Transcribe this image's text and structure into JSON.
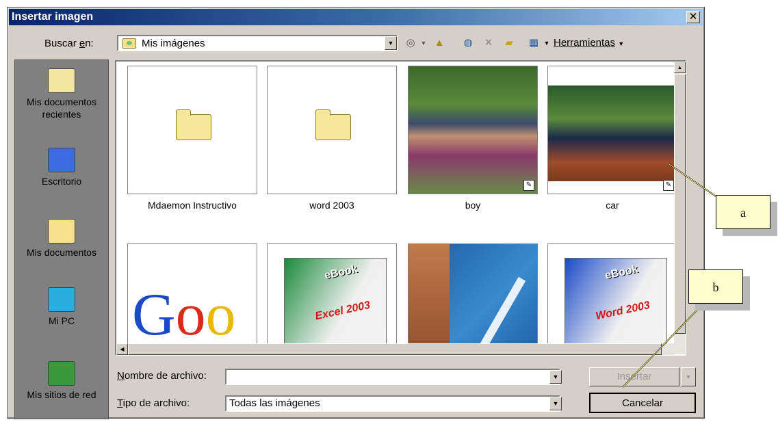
{
  "dialog": {
    "title": "Insertar imagen",
    "close_glyph": "✕"
  },
  "toolbar": {
    "look_in_label_pre": "Buscar ",
    "look_in_label_key": "e",
    "look_in_label_post": "n:",
    "look_in_value": "Mis imágenes",
    "tools_label": "Herramientas",
    "icons": [
      "back-icon",
      "up-folder-icon",
      "search-web-icon",
      "delete-icon",
      "new-folder-icon",
      "views-icon"
    ]
  },
  "places": [
    {
      "label": "Mis documentos recientes",
      "icon": "recent-documents-icon"
    },
    {
      "label": "Escritorio",
      "icon": "desktop-icon"
    },
    {
      "label": "Mis documentos",
      "icon": "my-documents-icon"
    },
    {
      "label": "Mi PC",
      "icon": "my-computer-icon"
    },
    {
      "label": "Mis sitios de red",
      "icon": "network-places-icon"
    }
  ],
  "files": [
    {
      "name": "Mdaemon Instructivo",
      "type": "folder"
    },
    {
      "name": "word 2003",
      "type": "folder"
    },
    {
      "name": "boy",
      "type": "image"
    },
    {
      "name": "car",
      "type": "image"
    },
    {
      "name": "",
      "type": "image",
      "text": "Goo"
    },
    {
      "name": "",
      "type": "image",
      "text": "eBook Microsoft Excel 2003"
    },
    {
      "name": "",
      "type": "image"
    },
    {
      "name": "",
      "type": "image",
      "text": "eBook Microsoft Word 2003"
    }
  ],
  "bottom": {
    "filename_label_key": "N",
    "filename_label_post": "ombre de archivo:",
    "filename_value": "",
    "filetype_label_key": "T",
    "filetype_label_post": "ipo de archivo:",
    "filetype_value": "Todas las imágenes",
    "insert_label": "Insertar",
    "cancel_label": "Cancelar"
  },
  "annotations": {
    "a": "a",
    "b": "b"
  },
  "colors": {
    "title_bar": "#0a246a",
    "dialog_face": "#d4d0c8",
    "callout": "#ffffcc"
  }
}
